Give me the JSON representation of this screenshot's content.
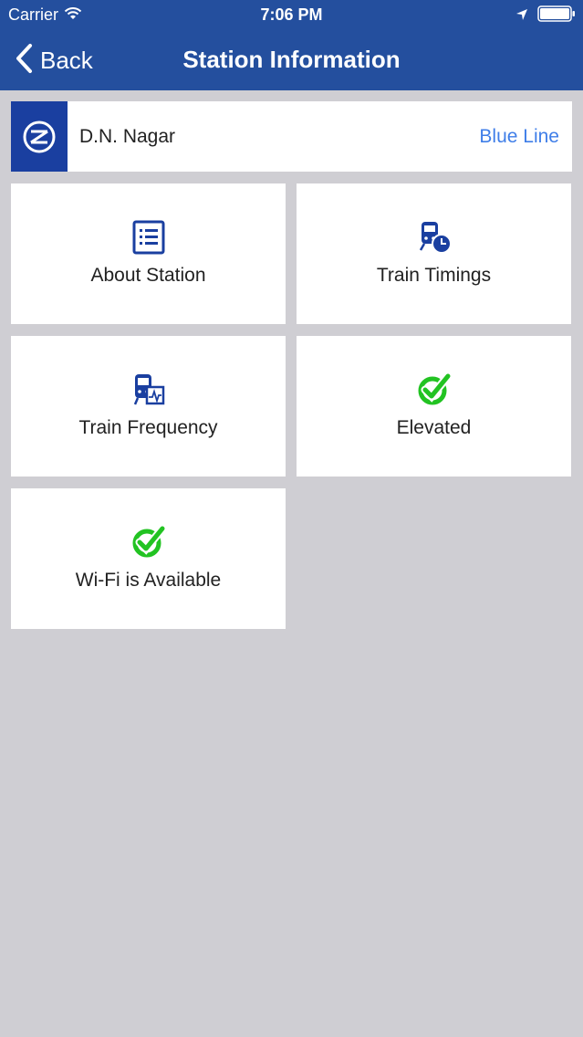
{
  "status_bar": {
    "carrier": "Carrier",
    "time": "7:06 PM"
  },
  "nav": {
    "back_label": "Back",
    "title": "Station Information"
  },
  "station": {
    "name": "D.N. Nagar",
    "line": "Blue Line"
  },
  "tiles": [
    {
      "label": "About Station",
      "icon": "document-list-icon"
    },
    {
      "label": "Train Timings",
      "icon": "train-clock-icon"
    },
    {
      "label": "Train Frequency",
      "icon": "train-frequency-icon"
    },
    {
      "label": "Elevated",
      "icon": "green-check-icon"
    },
    {
      "label": "Wi-Fi is Available",
      "icon": "green-check-icon"
    }
  ],
  "colors": {
    "nav_background": "#244f9e",
    "page_background": "#cfced3",
    "logo_background": "#1a3fa0",
    "line_text": "#3f7ee8",
    "check_green": "#22c322"
  }
}
